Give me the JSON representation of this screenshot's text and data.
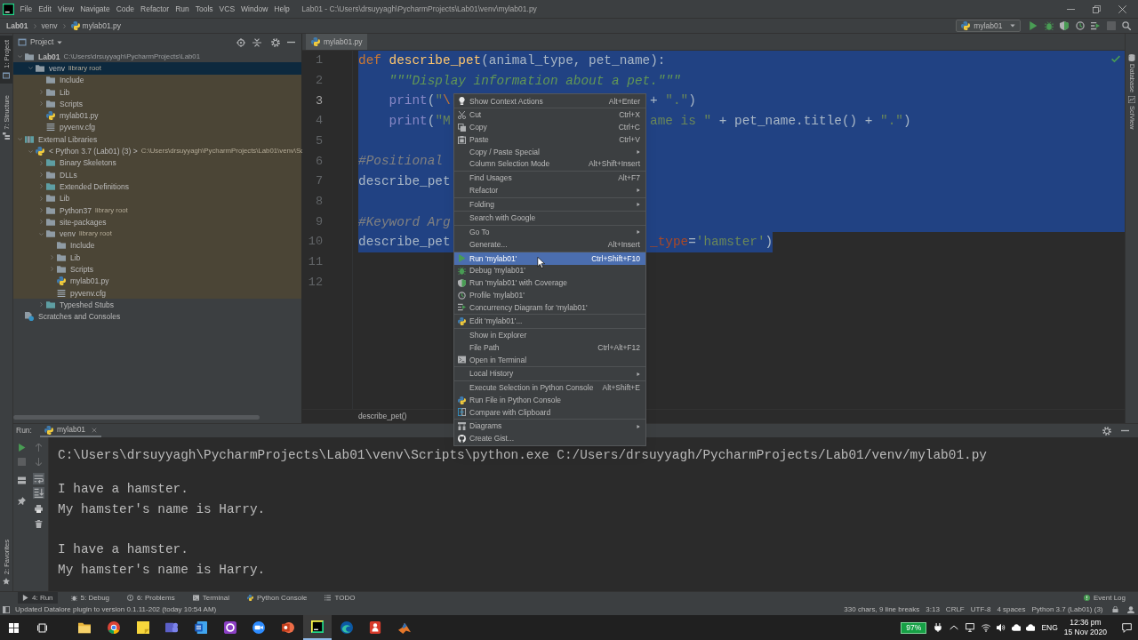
{
  "menu_bar": {
    "items": [
      "File",
      "Edit",
      "View",
      "Navigate",
      "Code",
      "Refactor",
      "Run",
      "Tools",
      "VCS",
      "Window",
      "Help"
    ],
    "title": "Lab01 - C:\\Users\\drsuyyagh\\PycharmProjects\\Lab01\\venv\\mylab01.py"
  },
  "navigation_bar": {
    "breadcrumbs": [
      "Lab01",
      "venv",
      "mylab01.py"
    ],
    "run_configuration": "mylab01"
  },
  "left_tool_strip": {
    "top": [
      {
        "label": "1: Project",
        "selected": true
      },
      {
        "label": "7: Structure",
        "selected": false
      }
    ],
    "bottom": [
      {
        "label": "2: Favorites",
        "selected": false
      }
    ]
  },
  "right_tool_strip": [
    "Database",
    "SciView"
  ],
  "project_panel": {
    "title": "Project",
    "tree": [
      {
        "label": "Lab01",
        "hint": "C:\\Users\\drsuyyagh\\PycharmProjects\\Lab01",
        "kind": "project-folder",
        "expanded": true,
        "selected": false,
        "library": false,
        "children": [
          {
            "label": "venv",
            "hint": "library root",
            "kind": "folder",
            "expanded": true,
            "selected": true,
            "library": true,
            "children": [
              {
                "label": "Include",
                "kind": "folder",
                "selected": false,
                "library": true
              },
              {
                "label": "Lib",
                "kind": "folder",
                "expanded": false,
                "selected": false,
                "library": true
              },
              {
                "label": "Scripts",
                "kind": "folder",
                "expanded": false,
                "selected": false,
                "library": true
              },
              {
                "label": "mylab01.py",
                "kind": "python-file",
                "selected": false,
                "library": true
              },
              {
                "label": "pyvenv.cfg",
                "kind": "text-file",
                "selected": false,
                "library": true
              }
            ]
          }
        ]
      },
      {
        "label": "External Libraries",
        "kind": "libraries",
        "expanded": true,
        "selected": false,
        "library": true,
        "children": [
          {
            "label": "< Python 3.7 (Lab01) (3) >",
            "hint": "C:\\Users\\drsuyyagh\\PycharmProjects\\Lab01\\venv\\Sc",
            "kind": "python-sdk",
            "expanded": true,
            "selected": false,
            "library": true,
            "children": [
              {
                "label": "Binary Skeletons",
                "kind": "library-folder",
                "expanded": false,
                "selected": false,
                "library": true
              },
              {
                "label": "DLLs",
                "kind": "folder",
                "expanded": false,
                "selected": false,
                "library": true
              },
              {
                "label": "Extended Definitions",
                "kind": "library-folder",
                "expanded": false,
                "selected": false,
                "library": true
              },
              {
                "label": "Lib",
                "kind": "folder",
                "expanded": false,
                "selected": false,
                "library": true
              },
              {
                "label": "Python37",
                "hint": "library root",
                "kind": "folder",
                "expanded": false,
                "selected": false,
                "library": true
              },
              {
                "label": "site-packages",
                "kind": "folder",
                "expanded": false,
                "selected": false,
                "library": true
              },
              {
                "label": "venv",
                "hint": "library root",
                "kind": "folder",
                "expanded": true,
                "selected": false,
                "library": true,
                "children": [
                  {
                    "label": "Include",
                    "kind": "folder",
                    "selected": false,
                    "library": true
                  },
                  {
                    "label": "Lib",
                    "kind": "folder",
                    "expanded": false,
                    "selected": false,
                    "library": true
                  },
                  {
                    "label": "Scripts",
                    "kind": "folder",
                    "expanded": false,
                    "selected": false,
                    "library": true
                  },
                  {
                    "label": "mylab01.py",
                    "kind": "python-file",
                    "selected": false,
                    "library": true
                  },
                  {
                    "label": "pyvenv.cfg",
                    "kind": "text-file",
                    "selected": false,
                    "library": true
                  }
                ]
              },
              {
                "label": "Typeshed Stubs",
                "kind": "library-folder",
                "expanded": false,
                "selected": false,
                "library": false
              }
            ]
          }
        ]
      },
      {
        "label": "Scratches and Consoles",
        "kind": "scratches",
        "selected": false,
        "library": false
      }
    ]
  },
  "editor": {
    "tabs": [
      {
        "label": "mylab01.py",
        "selected": true
      }
    ],
    "lines": [
      {
        "number": "1",
        "selected": true,
        "current": false,
        "tokens": [
          {
            "kind": "keyword",
            "text": "def "
          },
          {
            "kind": "function",
            "text": "describe_pet"
          },
          {
            "kind": "plain",
            "text": "(animal_type, pet_name):"
          }
        ]
      },
      {
        "number": "2",
        "selected": true,
        "current": false,
        "tokens": [
          {
            "kind": "docstring",
            "text": "    \"\"\"Display information about a pet.\"\"\""
          }
        ]
      },
      {
        "number": "3",
        "selected": true,
        "current": true,
        "tokens": [
          {
            "kind": "builtin",
            "text": "    print"
          },
          {
            "kind": "plain",
            "text": "("
          },
          {
            "kind": "string",
            "text": "\""
          },
          {
            "kind": "escape",
            "text": "\\"
          }
        ],
        "right_tokens": [
          {
            "kind": "plain",
            "text": "+ "
          },
          {
            "kind": "string",
            "text": "\".\""
          },
          {
            "kind": "plain",
            "text": ")"
          }
        ]
      },
      {
        "number": "4",
        "selected": true,
        "current": false,
        "tokens": [
          {
            "kind": "builtin",
            "text": "    print"
          },
          {
            "kind": "plain",
            "text": "("
          },
          {
            "kind": "string",
            "text": "\"M"
          }
        ],
        "right_tokens": [
          {
            "kind": "string",
            "text": "ame is \""
          },
          {
            "kind": "plain",
            "text": " + pet_name.title() + "
          },
          {
            "kind": "string",
            "text": "\".\""
          },
          {
            "kind": "plain",
            "text": ")"
          }
        ]
      },
      {
        "number": "5",
        "selected": true,
        "current": false
      },
      {
        "number": "6",
        "selected": true,
        "current": false,
        "tokens": [
          {
            "kind": "comment",
            "text": "#Positional"
          }
        ]
      },
      {
        "number": "7",
        "selected": true,
        "current": false,
        "tokens": [
          {
            "kind": "plain",
            "text": "describe_pet"
          }
        ]
      },
      {
        "number": "8",
        "selected": true,
        "current": false
      },
      {
        "number": "9",
        "selected": true,
        "current": false,
        "tokens": [
          {
            "kind": "comment",
            "text": "#Keyword Arg"
          }
        ]
      },
      {
        "number": "10",
        "selected": true,
        "current": false,
        "tokens": [
          {
            "kind": "plain",
            "text": "describe_pet"
          }
        ],
        "right_tokens": [
          {
            "kind": "kwarg",
            "text": "_type"
          },
          {
            "kind": "plain",
            "text": "="
          },
          {
            "kind": "string",
            "text": "'hamster'"
          },
          {
            "kind": "plain",
            "text": ")"
          }
        ]
      },
      {
        "number": "11",
        "selected": false,
        "current": false
      },
      {
        "number": "12",
        "selected": false,
        "current": false
      }
    ],
    "breadcrumb": "describe_pet()"
  },
  "context_menu": {
    "groups": [
      [
        {
          "label": "Show Context Actions",
          "shortcut": "Alt+Enter",
          "submenu": false,
          "selected": false
        }
      ],
      [
        {
          "label": "Cut",
          "shortcut": "Ctrl+X",
          "submenu": false,
          "selected": false
        },
        {
          "label": "Copy",
          "shortcut": "Ctrl+C",
          "submenu": false,
          "selected": false
        },
        {
          "label": "Paste",
          "shortcut": "Ctrl+V",
          "submenu": false,
          "selected": false
        },
        {
          "label": "Copy / Paste Special",
          "submenu": true,
          "selected": false
        },
        {
          "label": "Column Selection Mode",
          "shortcut": "Alt+Shift+Insert",
          "submenu": false,
          "selected": false
        }
      ],
      [
        {
          "label": "Find Usages",
          "shortcut": "Alt+F7",
          "submenu": false,
          "selected": false
        },
        {
          "label": "Refactor",
          "submenu": true,
          "selected": false
        }
      ],
      [
        {
          "label": "Folding",
          "submenu": true,
          "selected": false
        }
      ],
      [
        {
          "label": "Search with Google",
          "submenu": false,
          "selected": false
        }
      ],
      [
        {
          "label": "Go To",
          "submenu": true,
          "selected": false
        },
        {
          "label": "Generate...",
          "shortcut": "Alt+Insert",
          "submenu": false,
          "selected": false
        }
      ],
      [
        {
          "label": "Run 'mylab01'",
          "shortcut": "Ctrl+Shift+F10",
          "submenu": false,
          "selected": true
        },
        {
          "label": "Debug 'mylab01'",
          "submenu": false,
          "selected": false
        },
        {
          "label": "Run 'mylab01' with Coverage",
          "submenu": false,
          "selected": false
        },
        {
          "label": "Profile 'mylab01'",
          "submenu": false,
          "selected": false
        },
        {
          "label": "Concurrency Diagram for 'mylab01'",
          "submenu": false,
          "selected": false
        }
      ],
      [
        {
          "label": "Edit 'mylab01'...",
          "submenu": false,
          "selected": false
        }
      ],
      [
        {
          "label": "Show in Explorer",
          "submenu": false,
          "selected": false
        },
        {
          "label": "File Path",
          "shortcut": "Ctrl+Alt+F12",
          "submenu": false,
          "selected": false
        },
        {
          "label": "Open in Terminal",
          "submenu": false,
          "selected": false
        }
      ],
      [
        {
          "label": "Local History",
          "submenu": true,
          "selected": false
        }
      ],
      [
        {
          "label": "Execute Selection in Python Console",
          "shortcut": "Alt+Shift+E",
          "submenu": false,
          "selected": false
        },
        {
          "label": "Run File in Python Console",
          "submenu": false,
          "selected": false
        },
        {
          "label": "Compare with Clipboard",
          "submenu": false,
          "selected": false
        }
      ],
      [
        {
          "label": "Diagrams",
          "submenu": true,
          "selected": false
        },
        {
          "label": "Create Gist...",
          "submenu": false,
          "selected": false
        }
      ]
    ]
  },
  "run_panel": {
    "label": "Run:",
    "tab": "mylab01",
    "output": [
      [
        "C:\\Users\\drsuyyagh\\PycharmProjects\\Lab01\\venv\\Scripts\\python.exe C:/Users/drsuyyagh/PycharmProjects/Lab01/venv/mylab01.py"
      ],
      [
        "I have a hamster.",
        "My hamster's name is Harry."
      ],
      [
        "I have a hamster.",
        "My hamster's name is Harry."
      ]
    ]
  },
  "tool_window_bar": {
    "items": [
      {
        "label": "4: Run",
        "selected": true
      },
      {
        "label": "5: Debug",
        "selected": false
      },
      {
        "label": "6: Problems",
        "selected": false
      },
      {
        "label": "Terminal",
        "selected": false
      },
      {
        "label": "Python Console",
        "selected": false
      },
      {
        "label": "TODO",
        "selected": false
      }
    ],
    "event_log": "Event Log"
  },
  "status_bar": {
    "message": "Updated Datalore plugin to version 0.1.11-202 (today 10:54 AM)",
    "fields": [
      "330 chars, 9 line breaks",
      "3:13",
      "CRLF",
      "UTF-8",
      "4 spaces",
      "Python 3.7 (Lab01) (3)"
    ]
  },
  "taskbar": {
    "apps": [
      {
        "selected": false
      },
      {
        "selected": false
      },
      {
        "selected": false
      },
      {
        "selected": false
      },
      {
        "selected": false
      },
      {
        "selected": false
      },
      {
        "selected": false
      },
      {
        "selected": false
      },
      {
        "selected": true
      },
      {
        "selected": false
      },
      {
        "selected": false
      },
      {
        "selected": false
      }
    ],
    "battery": "97%",
    "language": "ENG",
    "time": "12:36 pm",
    "date": "15 Nov 2020"
  }
}
